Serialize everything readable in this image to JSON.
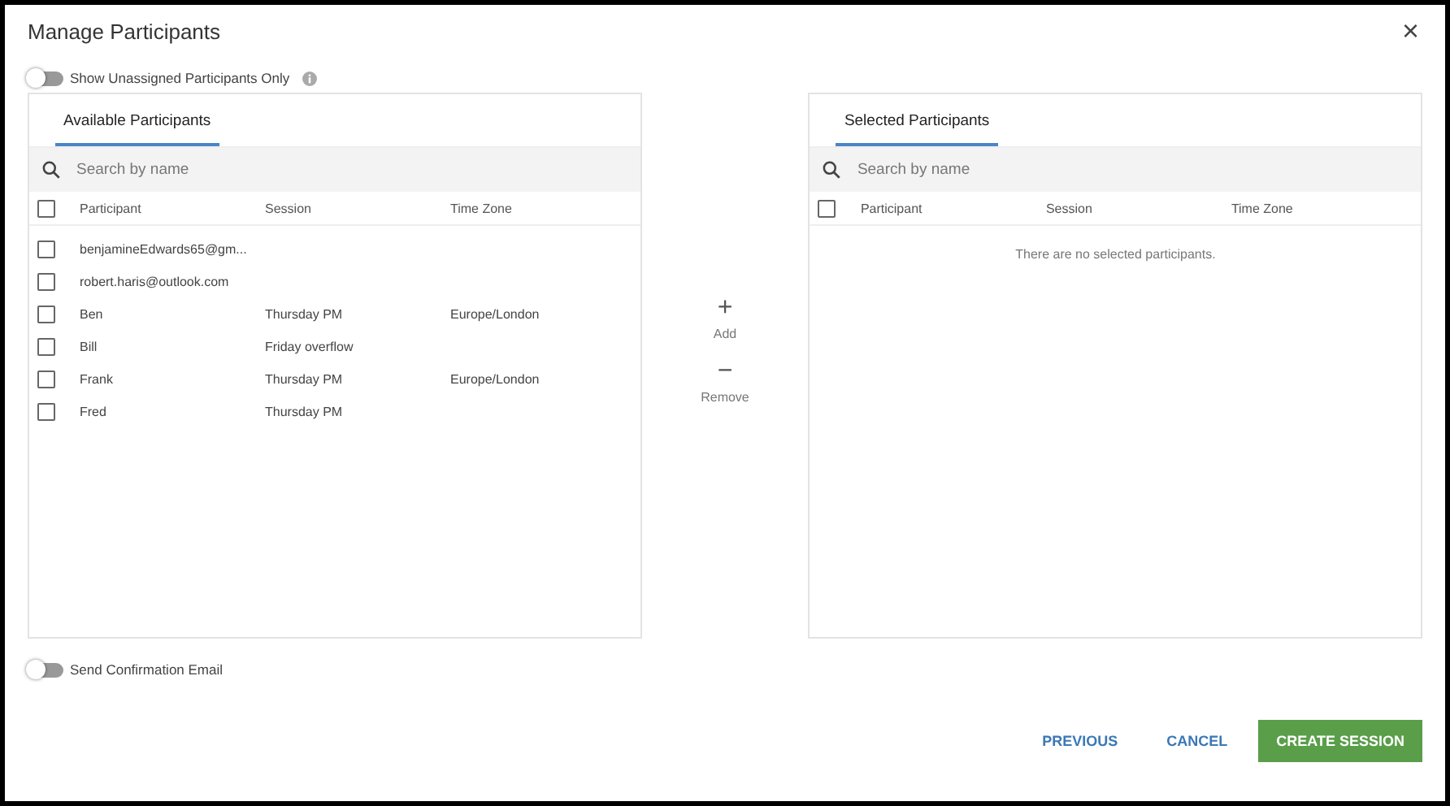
{
  "dialog": {
    "title": "Manage Participants",
    "close": "×"
  },
  "unassigned_toggle": {
    "label": "Show Unassigned Participants Only",
    "on": false
  },
  "available": {
    "tab": "Available Participants",
    "search": {
      "placeholder": "Search by name"
    },
    "select_all": false,
    "columns": [
      "Participant",
      "Session",
      "Time Zone"
    ],
    "rows": [
      {
        "participant": "benjamineEdwards65@gm...",
        "session": "",
        "time_zone": "",
        "checked": false
      },
      {
        "participant": "robert.haris@outlook.com",
        "session": "",
        "time_zone": "",
        "checked": false
      },
      {
        "participant": "Ben",
        "session": "Thursday PM",
        "time_zone": "Europe/London",
        "checked": false
      },
      {
        "participant": "Bill",
        "session": "Friday overflow",
        "time_zone": "",
        "checked": false
      },
      {
        "participant": "Frank",
        "session": "Thursday PM",
        "time_zone": "Europe/London",
        "checked": false
      },
      {
        "participant": "Fred",
        "session": "Thursday PM",
        "time_zone": "",
        "checked": false
      }
    ]
  },
  "actions": {
    "add": {
      "icon": "+",
      "label": "Add"
    },
    "remove": {
      "icon": "−",
      "label": "Remove"
    }
  },
  "selected": {
    "tab": "Selected Participants",
    "search": {
      "placeholder": "Search by name"
    },
    "select_all": false,
    "columns": [
      "Participant",
      "Session",
      "Time Zone"
    ],
    "empty_message": "There are no selected participants."
  },
  "confirmation_toggle": {
    "label": "Send Confirmation Email",
    "on": false
  },
  "buttons": [
    {
      "label": "PREVIOUS",
      "kind": "text"
    },
    {
      "label": "CANCEL",
      "kind": "text"
    },
    {
      "label": "CREATE SESSION",
      "kind": "primary"
    }
  ]
}
